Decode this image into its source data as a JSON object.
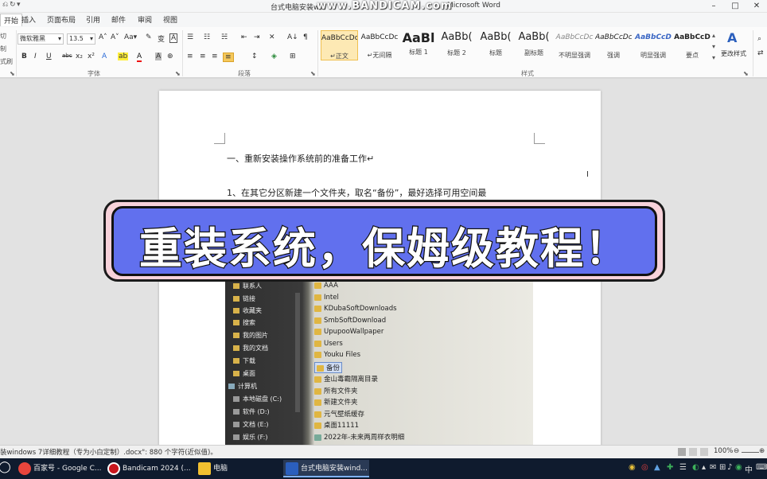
{
  "window": {
    "title_left": "台式电脑安装win",
    "title_right": "Microsoft Word",
    "watermark": "www.BANDICAM.com",
    "minimize": "–",
    "maximize": "□",
    "close": "✕"
  },
  "quick_access": [
    "⎌",
    "↻",
    "▾"
  ],
  "tabs": [
    "开始",
    "插入",
    "页面布局",
    "引用",
    "邮件",
    "审阅",
    "视图"
  ],
  "ribbon": {
    "clipboard_labels": [
      "切",
      "制",
      "式刷"
    ],
    "font_name": "微软雅黑",
    "font_size": "13.5",
    "font_buttons_row1": [
      "A˄",
      "A˅",
      "Aa▾",
      "✎",
      "变",
      "A"
    ],
    "font_buttons_row2": [
      "B",
      "I",
      "U",
      "abc",
      "x₂",
      "x²",
      "A",
      "ab",
      "A",
      "A",
      "⊕"
    ],
    "para_buttons_row1": [
      "☰",
      "☷",
      "☵",
      "⇤",
      "⇥",
      "✕",
      "A↓",
      "¶"
    ],
    "para_buttons_row2": [
      "≡",
      "≡",
      "≡",
      "≡",
      "↕",
      "◈",
      "⊞"
    ],
    "group_font": "字体",
    "group_paragraph": "段落",
    "group_styles": "样式",
    "change_styles": "更改样式",
    "styles": [
      {
        "sample": "AaBbCcDc",
        "name": "↵正文"
      },
      {
        "sample": "AaBbCcDc",
        "name": "↵无间隔"
      },
      {
        "sample": "AaBl",
        "name": "标题 1"
      },
      {
        "sample": "AaBb(",
        "name": "标题 2"
      },
      {
        "sample": "AaBb(",
        "name": "标题"
      },
      {
        "sample": "AaBb(",
        "name": "副标题"
      },
      {
        "sample": "AaBbCcDc",
        "name": "不明显强调"
      },
      {
        "sample": "AaBbCcDc",
        "name": "强调"
      },
      {
        "sample": "AaBbCcD",
        "name": "明显强调"
      },
      {
        "sample": "AaBbCcD",
        "name": "要点"
      }
    ]
  },
  "document": {
    "heading": "一、重新安装操作系统前的准备工作↵",
    "paragraph": "1、在其它分区新建一个文件夹，取名“备份”，最好选择可用空间最",
    "cursor": "I"
  },
  "photo": {
    "tree": [
      "联系人",
      "链接",
      "收藏夹",
      "搜索",
      "我的图片",
      "我的文档",
      "下载",
      "桌面",
      "计算机",
      "本地磁盘 (C:)",
      "软件 (D:)",
      "文档 (E:)",
      "娱乐 (F:)"
    ],
    "files": [
      "AAA",
      "Intel",
      "KDubaSoftDownloads",
      "SmbSoftDownload",
      "UpupooWallpaper",
      "Users",
      "Youku Files",
      "备份",
      "金山毒霸隔离目录",
      "所有文件夹",
      "新建文件夹",
      "元气壁纸缓存",
      "桌面11111",
      "2022年-未来两周样衣明细"
    ]
  },
  "banner": {
    "text": "重装系统，保姆级教程！"
  },
  "status": {
    "left": "装windows 7详细教程（专为小白定制）.docx\": 880 个字符(近似值)。",
    "zoom": "100%",
    "zoom_minus": "⊖",
    "zoom_plus": "⊕"
  },
  "taskbar": {
    "start": "◯",
    "items": [
      {
        "label": "百家号 - Google C...",
        "color": "#e8453c"
      },
      {
        "label": "Bandicam 2024 (...",
        "color": "#d22"
      },
      {
        "label": "电脑",
        "color": "#f2c030"
      },
      {
        "label": "台式电脑安装wind...",
        "color": "#2b5fbd"
      }
    ],
    "tray_icons": [
      "◉",
      "◎",
      "▲",
      "✚",
      "☰",
      "◐",
      "▴",
      "✉",
      "⊞",
      "♪",
      "◉",
      "中",
      "⌨"
    ]
  }
}
